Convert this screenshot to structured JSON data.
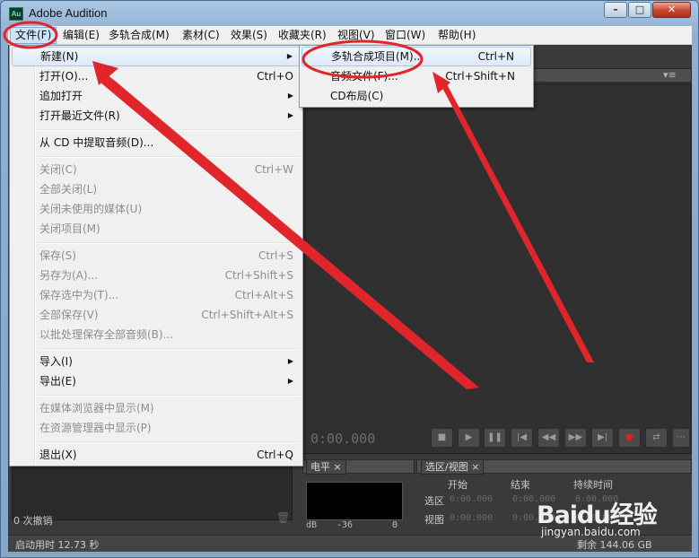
{
  "window": {
    "app_icon_text": "Au",
    "title": "Adobe Audition",
    "minimize": "–",
    "maximize": "□",
    "close": "✕"
  },
  "menubar": [
    "文件(F)",
    "编辑(E)",
    "多轨合成(M)",
    "素材(C)",
    "效果(S)",
    "收藏夹(R)",
    "视图(V)",
    "窗口(W)",
    "帮助(H)"
  ],
  "file_menu": {
    "items": [
      {
        "label": "新建(N)",
        "shortcut": "",
        "submenu": true,
        "enabled": true
      },
      {
        "label": "打开(O)...",
        "shortcut": "Ctrl+O",
        "submenu": false,
        "enabled": true
      },
      {
        "label": "追加打开",
        "shortcut": "",
        "submenu": true,
        "enabled": true
      },
      {
        "label": "打开最近文件(R)",
        "shortcut": "",
        "submenu": true,
        "enabled": true
      },
      {
        "label": "从 CD 中提取音频(D)...",
        "shortcut": "",
        "submenu": false,
        "enabled": true
      },
      {
        "label": "关闭(C)",
        "shortcut": "Ctrl+W",
        "submenu": false,
        "enabled": false
      },
      {
        "label": "全部关闭(L)",
        "shortcut": "",
        "submenu": false,
        "enabled": false
      },
      {
        "label": "关闭未使用的媒体(U)",
        "shortcut": "",
        "submenu": false,
        "enabled": false
      },
      {
        "label": "关闭项目(M)",
        "shortcut": "",
        "submenu": false,
        "enabled": false
      },
      {
        "label": "保存(S)",
        "shortcut": "Ctrl+S",
        "submenu": false,
        "enabled": false
      },
      {
        "label": "另存为(A)...",
        "shortcut": "Ctrl+Shift+S",
        "submenu": false,
        "enabled": false
      },
      {
        "label": "保存选中为(T)...",
        "shortcut": "Ctrl+Alt+S",
        "submenu": false,
        "enabled": false
      },
      {
        "label": "全部保存(V)",
        "shortcut": "Ctrl+Shift+Alt+S",
        "submenu": false,
        "enabled": false
      },
      {
        "label": "以批处理保存全部音频(B)...",
        "shortcut": "",
        "submenu": false,
        "enabled": false
      },
      {
        "label": "导入(I)",
        "shortcut": "",
        "submenu": true,
        "enabled": true
      },
      {
        "label": "导出(E)",
        "shortcut": "",
        "submenu": true,
        "enabled": true
      },
      {
        "label": "在媒体浏览器中显示(M)",
        "shortcut": "",
        "submenu": false,
        "enabled": false
      },
      {
        "label": "在资源管理器中显示(P)",
        "shortcut": "",
        "submenu": false,
        "enabled": false
      },
      {
        "label": "退出(X)",
        "shortcut": "Ctrl+Q",
        "submenu": false,
        "enabled": true
      }
    ]
  },
  "new_submenu": {
    "items": [
      {
        "label": "多轨合成项目(M)...",
        "shortcut": "Ctrl+N"
      },
      {
        "label": "音频文件(F)...",
        "shortcut": "Ctrl+Shift+N"
      },
      {
        "label": "CD布局(C)",
        "shortcut": ""
      }
    ]
  },
  "editor": {
    "timecode": "0:00.000",
    "transport": [
      "■",
      "▶",
      "❚❚",
      "|◀",
      "◀◀",
      "▶▶",
      "▶|",
      "●",
      "⇄",
      "⋯"
    ]
  },
  "history": {
    "undo_count": "0 次撤销",
    "trash": "🗑"
  },
  "levels": {
    "tab": "电平",
    "scale": [
      "dB",
      "-36",
      "0"
    ]
  },
  "selection_view": {
    "tab": "选区/视图",
    "headers": [
      "开始",
      "结束",
      "持续时间"
    ],
    "rows": [
      {
        "label": "选区",
        "start": "0:00.000",
        "end": "0:00.000",
        "duration": "0:00.000"
      },
      {
        "label": "视图",
        "start": "0:00.000",
        "end": "0:00.000",
        "duration": "0:00.000"
      }
    ]
  },
  "status": {
    "startup": "启动用时 12.73 秒",
    "free": "剩余 144.06 GB"
  },
  "watermark": {
    "brand": "Baidu经验",
    "url": "jingyan.baidu.com"
  },
  "annotation_color": "#e0262b"
}
